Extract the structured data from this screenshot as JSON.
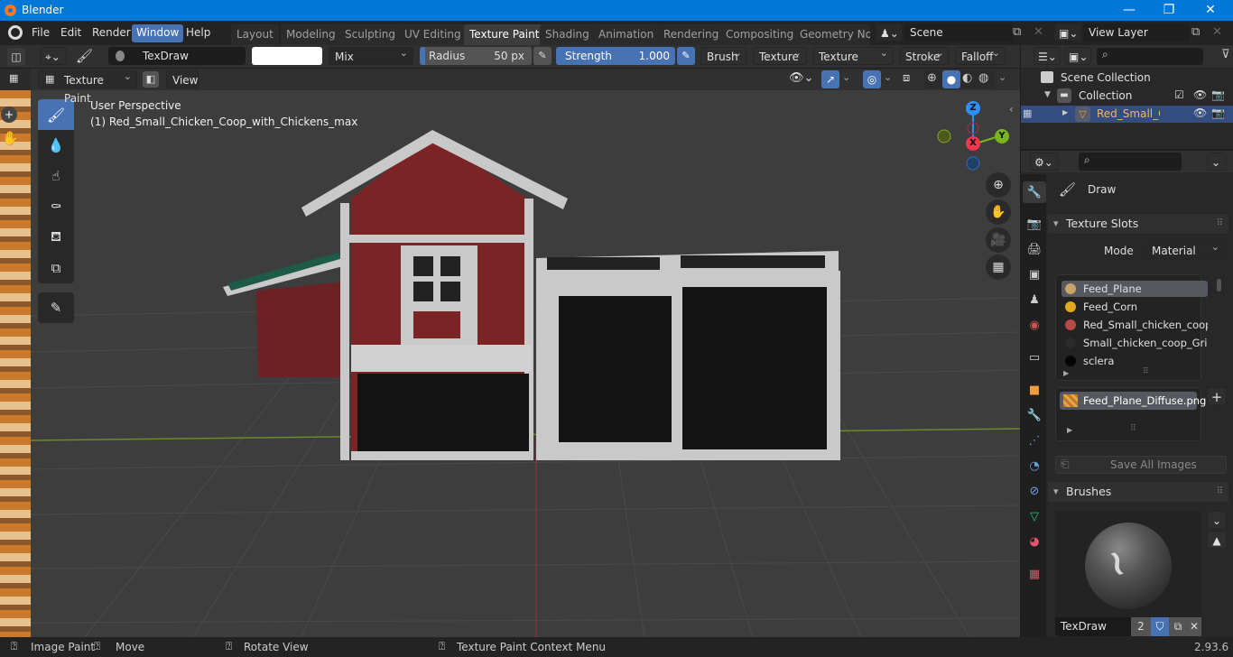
{
  "window": {
    "title": "Blender",
    "controls": {
      "minimize": "—",
      "maximize": "❐",
      "close": "✕"
    }
  },
  "menubar": {
    "items": [
      "File",
      "Edit",
      "Render",
      "Window",
      "Help"
    ],
    "active_item": "Window",
    "workspace_tabs": [
      "Layout",
      "Modeling",
      "Sculpting",
      "UV Editing",
      "Texture Paint",
      "Shading",
      "Animation",
      "Rendering",
      "Compositing",
      "Geometry Nod"
    ],
    "active_tab": "Texture Paint",
    "scene": "Scene",
    "view_layer": "View Layer"
  },
  "tool_header": {
    "brush_name": "TexDraw",
    "color_hex": "#ffffff",
    "blend_mode": "Mix",
    "radius_label": "Radius",
    "radius_value": "50 px",
    "strength_label": "Strength",
    "strength_value": "1.000",
    "strength_fraction": 1.0,
    "menus": [
      "Brush",
      "Texture",
      "Texture Mask",
      "Stroke",
      "Falloff"
    ]
  },
  "view_header": {
    "mode": "Texture Paint",
    "view_menu": "View"
  },
  "viewport": {
    "overlay_line1": "User Perspective",
    "overlay_line2": "(1) Red_Small_Chicken_Coop_with_Chickens_max",
    "gizmo": {
      "z": "Z",
      "y": "Y",
      "x": "X"
    },
    "colors": {
      "x_axis": "#f3354f",
      "y_axis": "#7ab51d",
      "z_axis": "#2e8ff5",
      "wall_red": "#7a2426",
      "frame": "#c9c9c9",
      "roof_green": "#1d5a48"
    }
  },
  "tools": [
    "draw",
    "soften",
    "smear",
    "clone",
    "fill",
    "mask",
    "annotate"
  ],
  "active_tool": "draw",
  "outliner": {
    "search_placeholder": "",
    "items": [
      {
        "label": "Scene Collection",
        "level": 0
      },
      {
        "label": "Collection",
        "level": 1
      },
      {
        "label": "Red_Small_Chick",
        "level": 2,
        "selected": true
      }
    ]
  },
  "properties": {
    "search_placeholder": "",
    "tool_name": "Draw",
    "texture_slots": {
      "title": "Texture Slots",
      "mode_label": "Mode",
      "mode_value": "Material",
      "materials": [
        {
          "name": "Feed_Plane",
          "color": "#c9a467",
          "active": true
        },
        {
          "name": "Feed_Corn",
          "color": "#e3a91c"
        },
        {
          "name": "Red_Small_chicken_coop...",
          "color": "#b84b45"
        },
        {
          "name": "Small_chicken_coop_Grid",
          "color": "#2b2b2b"
        },
        {
          "name": "sclera",
          "color": "#050505"
        }
      ],
      "image": "Feed_Plane_Diffuse.png",
      "save_all": "Save All Images"
    },
    "brushes": {
      "title": "Brushes",
      "brush_name": "TexDraw",
      "user_count": "2"
    }
  },
  "statusbar": {
    "hints": [
      "Image Paint",
      "Move",
      "Rotate View",
      "Texture Paint Context Menu"
    ],
    "version": "2.93.6"
  }
}
